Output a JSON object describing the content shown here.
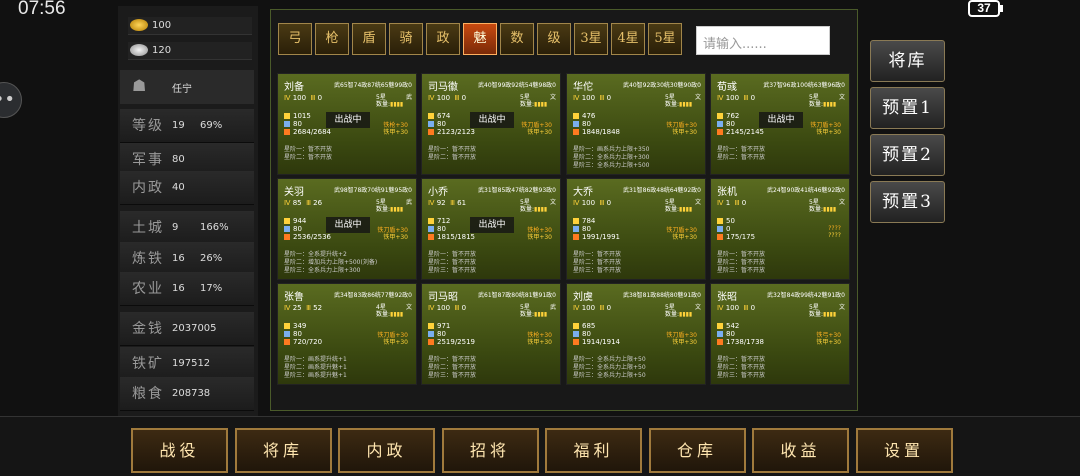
{
  "status": {
    "time": "07:56",
    "battery": "37"
  },
  "resources": {
    "gold": "100",
    "silver": "120"
  },
  "player": {
    "name": "任宁"
  },
  "stats": [
    {
      "label": "等级",
      "v1": "19",
      "v2": "69%"
    },
    {
      "label": "军事",
      "v1": "80",
      "v2": ""
    },
    {
      "label": "内政",
      "v1": "40",
      "v2": ""
    },
    {
      "label": "土城",
      "v1": "9",
      "v2": "166%"
    },
    {
      "label": "炼铁",
      "v1": "16",
      "v2": "26%"
    },
    {
      "label": "农业",
      "v1": "16",
      "v2": "17%"
    },
    {
      "label": "金钱",
      "v1": "2037005",
      "v2": ""
    },
    {
      "label": "铁矿",
      "v1": "197512",
      "v2": ""
    },
    {
      "label": "粮食",
      "v1": "208738",
      "v2": ""
    }
  ],
  "filters": [
    "弓",
    "枪",
    "盾",
    "骑",
    "政",
    "魅",
    "数",
    "级",
    "3星",
    "4星",
    "5星"
  ],
  "search": {
    "placeholder": "请输入......"
  },
  "side_buttons": [
    "将库",
    "预置1",
    "预置2",
    "预置3"
  ],
  "bottom_buttons": [
    "战役",
    "将库",
    "内政",
    "招将",
    "福利",
    "仓库",
    "收益",
    "设置"
  ],
  "generals": [
    {
      "name": "刘备",
      "attr": "武65智74政87统65魅99政0",
      "lv": "100",
      "p": "0",
      "star": "5星",
      "type": "武",
      "qty": "数量:",
      "s1": "1015",
      "s2": "80",
      "s3": "2684/2684",
      "bonus1": "铁枪+30",
      "bonus2": "铁甲+30",
      "duty": "出战中",
      "stages": [
        "星阶一：暂不开放",
        "星阶二：暂不开放"
      ]
    },
    {
      "name": "司马徽",
      "attr": "武40智99政92统54魅98政0",
      "lv": "100",
      "p": "0",
      "star": "5星",
      "type": "文",
      "qty": "数量:",
      "s1": "674",
      "s2": "80",
      "s3": "2123/2123",
      "bonus1": "铁刀盾+30",
      "bonus2": "铁甲+30",
      "duty": "出战中",
      "stages": [
        "星阶一：暂不开放",
        "星阶二：暂不开放"
      ]
    },
    {
      "name": "华佗",
      "attr": "武40智92政30统30魅90政0",
      "lv": "100",
      "p": "0",
      "star": "5星",
      "type": "文",
      "qty": "数量:",
      "s1": "476",
      "s2": "80",
      "s3": "1848/1848",
      "bonus1": "铁刀盾+30",
      "bonus2": "铁甲+30",
      "duty": "",
      "stages": [
        "星阶一：画系兵力上限+350",
        "星阶二：全系兵力上限+300",
        "星阶三：全系兵力上限+500"
      ]
    },
    {
      "name": "荀彧",
      "attr": "武37智96政100统63魅96政0",
      "lv": "100",
      "p": "0",
      "star": "5星",
      "type": "文",
      "qty": "数量:",
      "s1": "762",
      "s2": "80",
      "s3": "2145/2145",
      "bonus1": "铁刀盾+30",
      "bonus2": "铁甲+30",
      "duty": "出战中",
      "stages": [
        "星阶一：暂不开放",
        "星阶二：暂不开放"
      ]
    },
    {
      "name": "关羽",
      "attr": "武98智78政70统91魅95政0",
      "lv": "85",
      "p": "26",
      "star": "5星",
      "type": "武",
      "qty": "数量:",
      "s1": "944",
      "s2": "80",
      "s3": "2536/2536",
      "bonus1": "铁刀盾+30",
      "bonus2": "铁甲+30",
      "duty": "出战中",
      "stages": [
        "星阶一：全系提升统+2",
        "星阶二：增加兵力上限+500(刘备)",
        "星阶三：全系兵力上限+300"
      ]
    },
    {
      "name": "小乔",
      "attr": "武31智85政47统82魅93政0",
      "lv": "92",
      "p": "61",
      "star": "5星",
      "type": "文",
      "qty": "数量:",
      "s1": "712",
      "s2": "80",
      "s3": "1815/1815",
      "bonus1": "铁枪+30",
      "bonus2": "铁甲+30",
      "duty": "出战中",
      "stages": [
        "星阶一：暂不开放",
        "星阶二：暂不开放",
        "星阶三：暂不开放"
      ]
    },
    {
      "name": "大乔",
      "attr": "武31智86政48统64魅92政0",
      "lv": "100",
      "p": "0",
      "star": "5星",
      "type": "文",
      "qty": "数量:",
      "s1": "784",
      "s2": "80",
      "s3": "1991/1991",
      "bonus1": "铁刀盾+30",
      "bonus2": "铁甲+30",
      "duty": "",
      "stages": [
        "星阶一：暂不开放",
        "星阶二：暂不开放",
        "星阶三：暂不开放"
      ]
    },
    {
      "name": "张机",
      "attr": "武24智90政41统46魅92政0",
      "lv": "1",
      "p": "0",
      "star": "5星",
      "type": "文",
      "qty": "数量:",
      "s1": "50",
      "s2": "0",
      "s3": "175/175",
      "bonus1": "????",
      "bonus2": "????",
      "duty": "",
      "stages": [
        "星阶一：暂不开放",
        "星阶二：暂不开放",
        "星阶三：暂不开放"
      ]
    },
    {
      "name": "张鲁",
      "attr": "武34智83政86统77魅92政0",
      "lv": "25",
      "p": "52",
      "star": "4星",
      "type": "文",
      "qty": "数量:",
      "s1": "349",
      "s2": "80",
      "s3": "720/720",
      "bonus1": "铁刀盾+30",
      "bonus2": "铁甲+30",
      "duty": "",
      "stages": [
        "星阶一：画系提升统+1",
        "星阶二：画系提升魅+1",
        "星阶三：画系提升魅+1"
      ]
    },
    {
      "name": "司马昭",
      "attr": "武61智87政80统81魅91政0",
      "lv": "100",
      "p": "0",
      "star": "5星",
      "type": "武",
      "qty": "数量:",
      "s1": "971",
      "s2": "80",
      "s3": "2519/2519",
      "bonus1": "铁枪+30",
      "bonus2": "铁甲+30",
      "duty": "",
      "stages": [
        "星阶一：暂不开放",
        "星阶二：暂不开放",
        "星阶三：暂不开放"
      ]
    },
    {
      "name": "刘虞",
      "attr": "武38智81政88统80魅91政0",
      "lv": "100",
      "p": "0",
      "star": "5星",
      "type": "文",
      "qty": "数量:",
      "s1": "685",
      "s2": "80",
      "s3": "1914/1914",
      "bonus1": "铁刀盾+30",
      "bonus2": "铁甲+30",
      "duty": "",
      "stages": [
        "星阶一：全系兵力上限+50",
        "星阶二：全系兵力上限+50",
        "星阶三：全系兵力上限+50"
      ]
    },
    {
      "name": "张昭",
      "attr": "武32智84政99统42魅91政0",
      "lv": "100",
      "p": "0",
      "star": "5星",
      "type": "文",
      "qty": "数量:",
      "s1": "542",
      "s2": "80",
      "s3": "1738/1738",
      "bonus1": "铁弓+30",
      "bonus2": "铁甲+30",
      "duty": "",
      "stages": [
        "星阶一：暂不开放",
        "星阶二：暂不开放",
        "星阶三：暂不开放"
      ]
    }
  ],
  "colors": {
    "card_bg": "#4a5a18",
    "accent_gold": "#ffd23a",
    "filter_active": "#c84a10",
    "button_border": "#a07a3c"
  }
}
